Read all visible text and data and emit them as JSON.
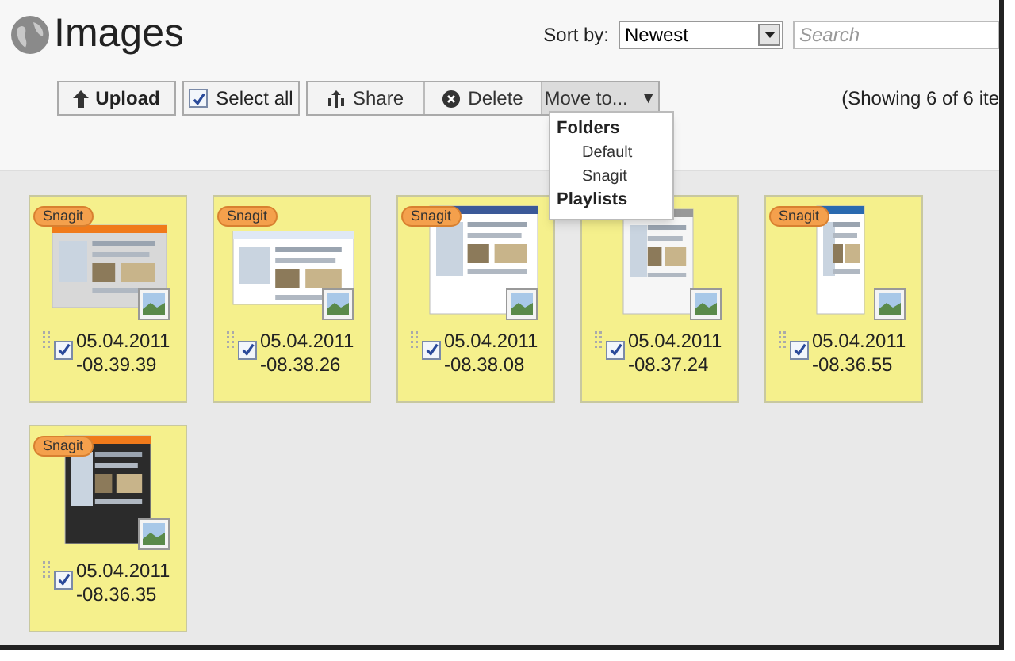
{
  "header": {
    "title": "Images",
    "sort_label": "Sort by:",
    "sort_value": "Newest",
    "search_placeholder": "Search"
  },
  "toolbar": {
    "upload": "Upload",
    "select_all": {
      "label": "Select all",
      "checked": true
    },
    "share": "Share",
    "delete": "Delete",
    "move_to": "Move to...",
    "move_caret": "▼",
    "showing": "(Showing 6 of 6 ite"
  },
  "menu": {
    "sections": [
      {
        "heading": "Folders",
        "items": [
          "Default",
          "Snagit"
        ]
      },
      {
        "heading": "Playlists"
      }
    ]
  },
  "images": [
    {
      "tag": "Snagit",
      "name": "05.04.2011-08.39.39",
      "checked": true,
      "selected": true
    },
    {
      "tag": "Snagit",
      "name": "05.04.2011-08.38.26",
      "checked": true,
      "selected": true
    },
    {
      "tag": "Snagit",
      "name": "05.04.2011-08.38.08",
      "checked": true,
      "selected": true
    },
    {
      "name": "05.04.2011-08.37.24",
      "checked": true,
      "selected": true
    },
    {
      "tag": "Snagit",
      "name": "05.04.2011-08.36.55",
      "checked": true,
      "selected": true
    },
    {
      "tag": "Snagit",
      "name": "05.04.2011-08.36.35",
      "checked": true,
      "selected": true
    }
  ]
}
